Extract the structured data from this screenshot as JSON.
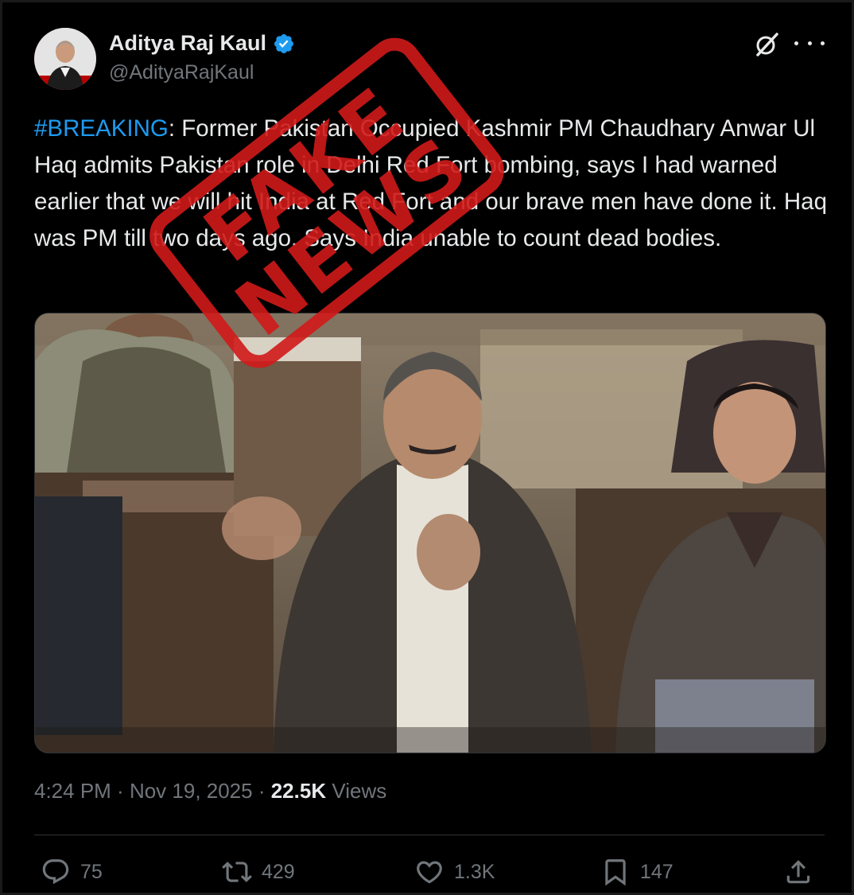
{
  "user": {
    "display_name": "Aditya Raj Kaul",
    "handle": "@AdityaRajKaul",
    "verified": true
  },
  "tweet": {
    "hashtag": "#BREAKING",
    "text": ": Former Pakistan Occupied Kashmir PM Chaudhary Anwar Ul Haq admits Pakistan role in Delhi Red Fort bombing, says I had warned earlier that we will hit India at Red Fort and our brave men have done it. Haq was PM till two days ago. Says India unable to count dead bodies."
  },
  "meta": {
    "time": "4:24 PM",
    "separator": " · ",
    "date": "Nov 19, 2025",
    "views_count": "22.5K",
    "views_label": " Views"
  },
  "actions": {
    "replies": "75",
    "reposts": "429",
    "likes": "1.3K",
    "bookmarks": "147"
  },
  "stamp": {
    "line1": "FAKE",
    "line2": "NEWS",
    "color": "#d11a1a"
  },
  "colors": {
    "background": "#000000",
    "text": "#e7e9ea",
    "secondary": "#71767b",
    "accent": "#1d9bf0"
  },
  "icons": [
    "verified-badge-icon",
    "grok-icon",
    "more-icon",
    "reply-icon",
    "repost-icon",
    "like-icon",
    "bookmark-icon",
    "share-icon"
  ]
}
